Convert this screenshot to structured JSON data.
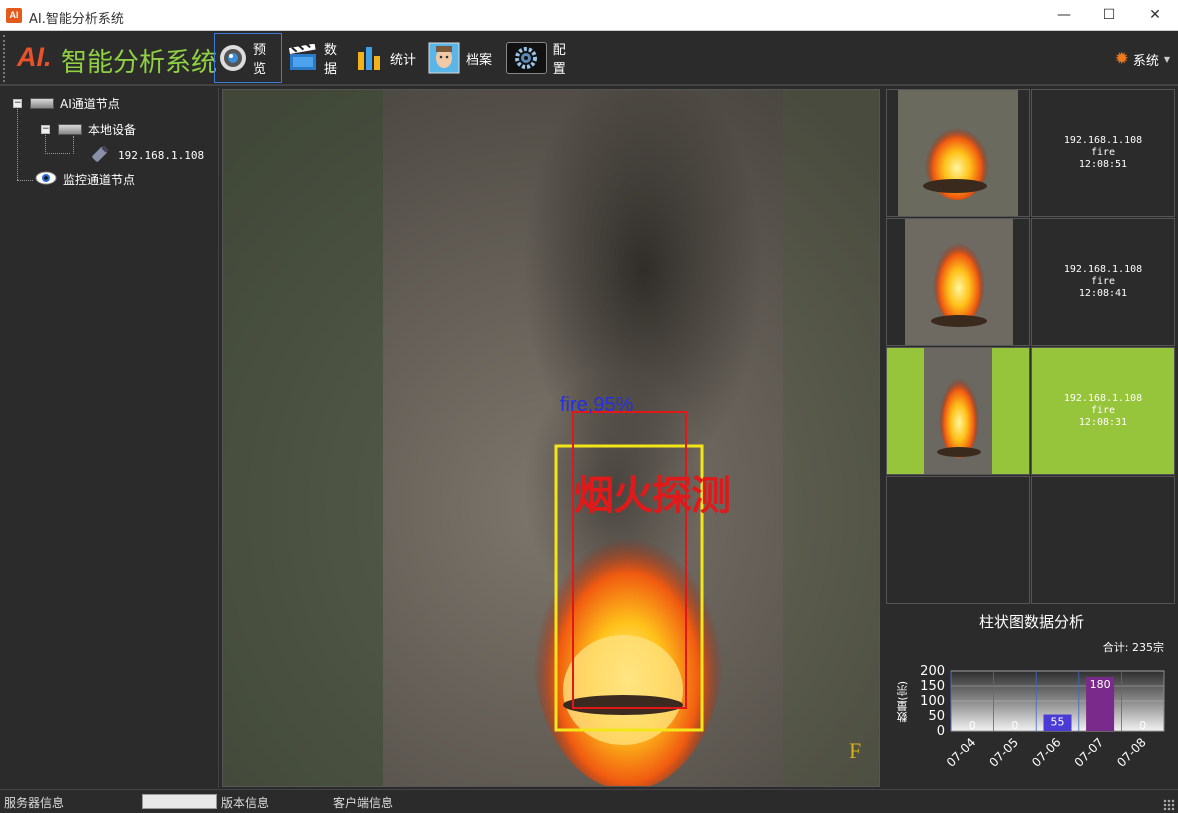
{
  "window": {
    "icon_text": "AI",
    "title": "AI.智能分析系统",
    "min": "—",
    "max": "☐",
    "close": "✕"
  },
  "toolbar": {
    "logo_ai": "AI.",
    "logo_text": "智能分析系统",
    "buttons": [
      {
        "label": "预览",
        "icon": "camera-lens-icon"
      },
      {
        "label": "数据",
        "icon": "clapperboard-icon"
      },
      {
        "label": "统计",
        "icon": "bar-chart-icon"
      },
      {
        "label": "档案",
        "icon": "face-profile-icon"
      },
      {
        "label": "配置",
        "icon": "gear-icon"
      }
    ],
    "system_label": "系统"
  },
  "tree": {
    "root": "AI通道节点",
    "device": "本地设备",
    "camera_ip": "192.168.1.108",
    "monitor": "监控通道节点",
    "expander": "−"
  },
  "video": {
    "detection_label": "fire,95%",
    "overlay_text": "烟火探测",
    "corner_mark": "F"
  },
  "thumbnails": [
    {
      "ip": "192.168.1.108",
      "type": "fire",
      "time": "12:08:51",
      "selected": false
    },
    {
      "ip": "192.168.1.108",
      "type": "fire",
      "time": "12:08:41",
      "selected": false
    },
    {
      "ip": "192.168.1.108",
      "type": "fire",
      "time": "12:08:31",
      "selected": true
    }
  ],
  "chart_data": {
    "type": "bar",
    "title": "柱状图数据分析",
    "total_label": "合计: 235宗",
    "ylabel": "数量(宗)",
    "categories": [
      "07-04",
      "07-05",
      "07-06",
      "07-07",
      "07-08"
    ],
    "values": [
      0,
      0,
      55,
      180,
      0
    ],
    "ylim": [
      0,
      200
    ],
    "yticks": [
      0,
      50,
      100,
      150,
      200
    ],
    "colors": {
      "07-06": "#4a3bd6",
      "07-07": "#7a2a8a"
    }
  },
  "status": {
    "server": "服务器信息",
    "version": "版本信息",
    "client": "客户端信息"
  }
}
